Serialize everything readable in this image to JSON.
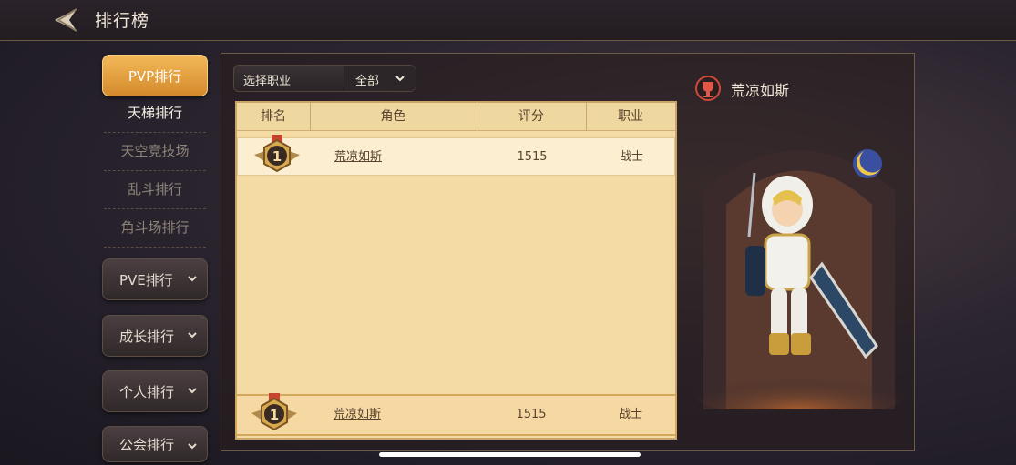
{
  "header": {
    "title": "排行榜",
    "back_icon": "back-arrow-icon"
  },
  "sidebar": {
    "tabs": [
      {
        "label": "PVP排行",
        "active": true
      },
      {
        "label": "PVE排行",
        "active": false
      },
      {
        "label": "成长排行",
        "active": false
      },
      {
        "label": "个人排行",
        "active": false
      },
      {
        "label": "公会排行",
        "active": false
      }
    ],
    "pvp_sub": [
      {
        "label": "天梯排行",
        "active": true
      },
      {
        "label": "天空竞技场",
        "active": false
      },
      {
        "label": "乱斗排行",
        "active": false
      },
      {
        "label": "角斗场排行",
        "active": false
      }
    ]
  },
  "filter": {
    "label": "选择职业",
    "value": "全部"
  },
  "table": {
    "columns": [
      "排名",
      "角色",
      "评分",
      "职业"
    ],
    "rows": [
      {
        "rank": "1",
        "name": "荒凉如斯",
        "score": "1515",
        "job": "战士"
      }
    ],
    "self_row": {
      "rank": "1",
      "name": "荒凉如斯",
      "score": "1515",
      "job": "战士"
    }
  },
  "character": {
    "name": "荒凉如斯",
    "icon": "trophy-badge-icon"
  },
  "colors": {
    "accent": "#e6a040",
    "table_bg": "#f4dba4",
    "highlight": "#f6d8a2"
  }
}
